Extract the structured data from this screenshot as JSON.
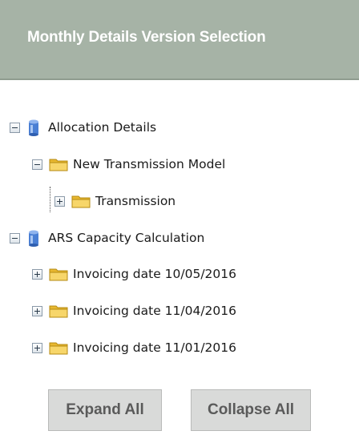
{
  "header": {
    "title": "Monthly Details Version Selection"
  },
  "tree": {
    "nodes": [
      {
        "label": "Allocation Details",
        "icon": "database-icon",
        "toggle": "collapse"
      },
      {
        "label": "New Transmission Model",
        "icon": "folder-icon",
        "toggle": "collapse"
      },
      {
        "label": "Transmission",
        "icon": "folder-icon",
        "toggle": "expand"
      },
      {
        "label": "ARS Capacity Calculation",
        "icon": "database-icon",
        "toggle": "collapse"
      },
      {
        "label": "Invoicing date 10/05/2016",
        "icon": "folder-icon",
        "toggle": "expand"
      },
      {
        "label": "Invoicing date 11/04/2016",
        "icon": "folder-icon",
        "toggle": "expand"
      },
      {
        "label": "Invoicing date 11/01/2016",
        "icon": "folder-icon",
        "toggle": "expand"
      }
    ]
  },
  "buttons": {
    "expand_all": "Expand All",
    "collapse_all": "Collapse All"
  },
  "colors": {
    "header_bg": "#a6b3a6",
    "button_bg": "#d9dad9",
    "folder": "#f2c94c",
    "database": "#4a7fd4"
  }
}
